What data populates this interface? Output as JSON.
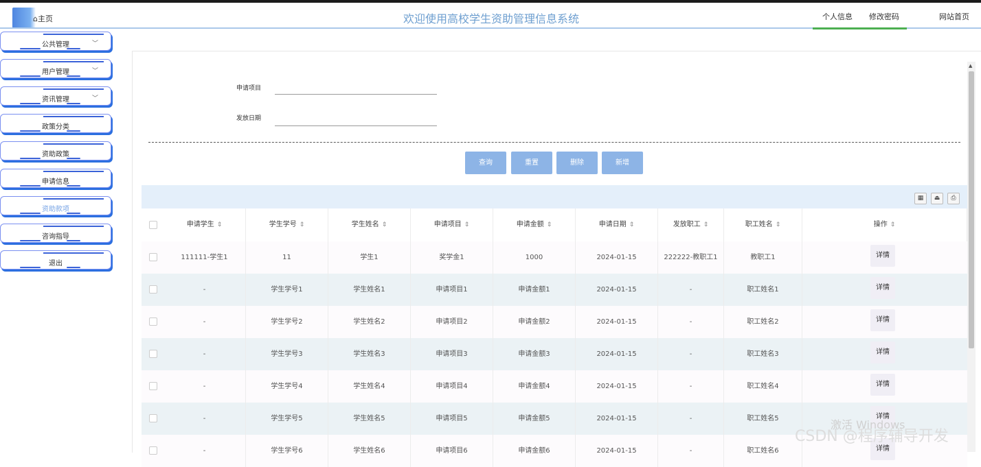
{
  "header": {
    "home_label": "主页",
    "title": "欢迎使用高校学生资助管理信息系统",
    "nav": {
      "profile": "个人信息",
      "password": "修改密码",
      "site_home": "网站首页"
    }
  },
  "sidebar": {
    "items": [
      {
        "label": "公共管理",
        "has_chevron": true
      },
      {
        "label": "用户管理",
        "has_chevron": true
      },
      {
        "label": "资讯管理",
        "has_chevron": true
      },
      {
        "label": "政策分类"
      },
      {
        "label": "资助政策"
      },
      {
        "label": "申请信息"
      },
      {
        "label": "资助款项",
        "active": true
      },
      {
        "label": "咨询指导"
      },
      {
        "label": "退出"
      }
    ]
  },
  "search": {
    "field1_label": "申请项目",
    "field2_label": "发放日期"
  },
  "buttons": {
    "query": "查询",
    "reset": "重置",
    "delete": "删除",
    "add": "新增"
  },
  "table": {
    "columns": [
      "申请学生",
      "学生学号",
      "学生姓名",
      "申请项目",
      "申请金额",
      "申请日期",
      "发放职工",
      "职工姓名",
      "操作"
    ],
    "detail_label": "详情",
    "rows": [
      [
        "111111-学生1",
        "11",
        "学生1",
        "奖学金1",
        "1000",
        "2024-01-15",
        "222222-教职工1",
        "教职工1"
      ],
      [
        "-",
        "学生学号1",
        "学生姓名1",
        "申请项目1",
        "申请金额1",
        "2024-01-15",
        "-",
        "职工姓名1"
      ],
      [
        "-",
        "学生学号2",
        "学生姓名2",
        "申请项目2",
        "申请金额2",
        "2024-01-15",
        "-",
        "职工姓名2"
      ],
      [
        "-",
        "学生学号3",
        "学生姓名3",
        "申请项目3",
        "申请金额3",
        "2024-01-15",
        "-",
        "职工姓名3"
      ],
      [
        "-",
        "学生学号4",
        "学生姓名4",
        "申请项目4",
        "申请金额4",
        "2024-01-15",
        "-",
        "职工姓名4"
      ],
      [
        "-",
        "学生学号5",
        "学生姓名5",
        "申请项目5",
        "申请金额5",
        "2024-01-15",
        "-",
        "职工姓名5"
      ],
      [
        "-",
        "学生学号6",
        "学生姓名6",
        "申请项目6",
        "申请金额6",
        "2024-01-15",
        "-",
        "职工姓名6"
      ]
    ]
  },
  "watermark": {
    "line1": "激活 Windows",
    "line2": "CSDN @程序辅导开发"
  },
  "colors": {
    "accent": "#8db4e6",
    "title": "#6e9fd0",
    "menu_border": "#7a8ff0"
  }
}
